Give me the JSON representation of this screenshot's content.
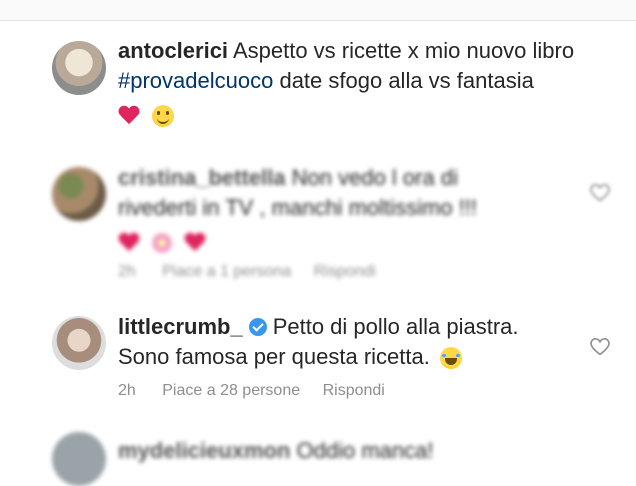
{
  "comments": [
    {
      "username": "antoclerici",
      "text_line1": "Aspetto vs ricette x mio nuovo libro",
      "hashtag": "#provadelcuoco",
      "text_line2_rest": " date sfogo alla vs fantasia",
      "emojis": [
        "heart-emoji",
        "smile-emoji"
      ]
    },
    {
      "username": "cristina_bettella",
      "text_line1": "Non vedo l ora di",
      "text_line2": "rivederti in TV , manchi moltissimo !!!",
      "emojis": [
        "heart-emoji",
        "flower-emoji",
        "heart-emoji"
      ],
      "time": "2h",
      "likes": "Piace a 1 persona",
      "reply": "Rispondi"
    },
    {
      "username": "littlecrumb_",
      "verified": true,
      "text_line1": "Petto di pollo alla piastra.",
      "text_line2": "Sono famosa per questa ricetta.",
      "emojis": [
        "laughing-emoji"
      ],
      "time": "2h",
      "likes": "Piace a 28 persone",
      "reply": "Rispondi"
    },
    {
      "username": "mydelicieuxmon",
      "text": "Oddio manca!"
    }
  ],
  "colors": {
    "hashtag": "#003569",
    "meta": "#8e8e8e",
    "verified": "#3897f0",
    "heart": "#e0245e"
  }
}
